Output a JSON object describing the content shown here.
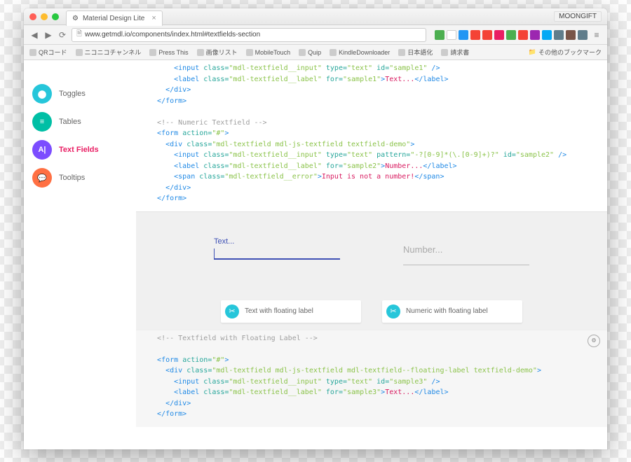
{
  "titlebar": {
    "tab_title": "Material Design Lite",
    "user_badge": "MOONGIFT"
  },
  "urlbar": {
    "url": "www.getmdl.io/components/index.html#textfields-section"
  },
  "bookmarks": {
    "items": [
      "QRコード",
      "ニコニコチャンネル",
      "Press This",
      "画像リスト",
      "MobileTouch",
      "Quip",
      "KindleDownloader",
      "日本語化",
      "請求書"
    ],
    "other": "その他のブックマーク"
  },
  "sidebar": {
    "items": [
      {
        "label": "Toggles",
        "color": "#26c6da",
        "glyph": "⬤"
      },
      {
        "label": "Tables",
        "color": "#00bfa5",
        "glyph": "≡"
      },
      {
        "label": "Text Fields",
        "color": "#7c4dff",
        "glyph": "A|"
      },
      {
        "label": "Tooltips",
        "color": "#ff7043",
        "glyph": "💬"
      }
    ],
    "active_index": 2
  },
  "code1": {
    "l1a": "<input",
    "l1b": "class=",
    "l1c": "\"mdl-textfield__input\"",
    "l1d": "type=",
    "l1e": "\"text\"",
    "l1f": "id=",
    "l1g": "\"sample1\"",
    "l1h": " />",
    "l2a": "<label",
    "l2b": "class=",
    "l2c": "\"mdl-textfield__label\"",
    "l2d": "for=",
    "l2e": "\"sample1\"",
    "l2f": ">",
    "l2g": "Text...",
    "l2h": "</label>",
    "l3": "</div>",
    "l4": "</form>",
    "cmt": "<!-- Numeric Textfield -->",
    "l5a": "<form",
    "l5b": "action=",
    "l5c": "\"#\"",
    "l5d": ">",
    "l6a": "<div",
    "l6b": "class=",
    "l6c": "\"mdl-textfield mdl-js-textfield textfield-demo\"",
    "l6d": ">",
    "l7a": "<input",
    "l7b": "class=",
    "l7c": "\"mdl-textfield__input\"",
    "l7d": "type=",
    "l7e": "\"text\"",
    "l7f": "pattern=",
    "l7g": "\"-?[0-9]*(\\.[0-9]+)?\"",
    "l7h": "id=",
    "l7i": "\"sample2\"",
    "l7j": " />",
    "l8a": "<label",
    "l8b": "class=",
    "l8c": "\"mdl-textfield__label\"",
    "l8d": "for=",
    "l8e": "\"sample2\"",
    "l8f": ">",
    "l8g": "Number...",
    "l8h": "</label>",
    "l9a": "<span",
    "l9b": "class=",
    "l9c": "\"mdl-textfield__error\"",
    "l9d": ">",
    "l9e": "Input is not a number!",
    "l9f": "</span>",
    "l10": "</div>",
    "l11": "</form>"
  },
  "demo": {
    "label1": "Text...",
    "placeholder2": "Number...",
    "chip1": "Text with floating label",
    "chip2": "Numeric with floating label"
  },
  "code2": {
    "cmt": "<!-- Textfield with Floating Label -->",
    "l1a": "<form",
    "l1b": "action=",
    "l1c": "\"#\"",
    "l1d": ">",
    "l2a": "<div",
    "l2b": "class=",
    "l2c": "\"mdl-textfield mdl-js-textfield mdl-textfield--floating-label textfield-demo\"",
    "l2d": ">",
    "l3a": "<input",
    "l3b": "class=",
    "l3c": "\"mdl-textfield__input\"",
    "l3d": "type=",
    "l3e": "\"text\"",
    "l3f": "id=",
    "l3g": "\"sample3\"",
    "l3h": " />",
    "l4a": "<label",
    "l4b": "class=",
    "l4c": "\"mdl-textfield__label\"",
    "l4d": "for=",
    "l4e": "\"sample3\"",
    "l4f": ">",
    "l4g": "Text...",
    "l4h": "</label>",
    "l5": "</div>",
    "l6": "</form>"
  },
  "ext_colors": [
    "#4caf50",
    "#fff",
    "#2196f3",
    "#f44336",
    "#f44336",
    "#e91e63",
    "#4caf50",
    "#f44336",
    "#9c27b0",
    "#03a9f4",
    "#607d8b",
    "#795548",
    "#607d8b"
  ]
}
